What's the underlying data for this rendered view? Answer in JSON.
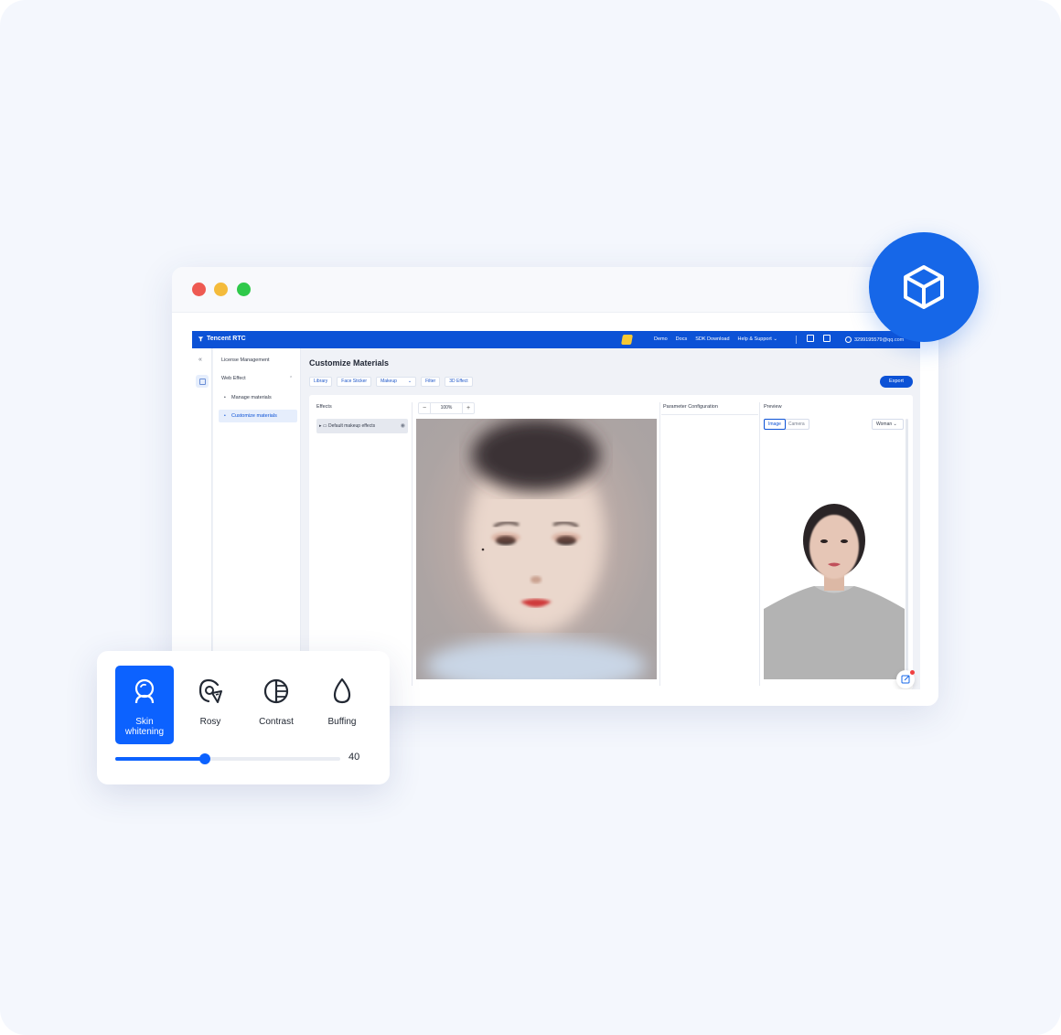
{
  "app": {
    "brand": "Tencent RTC",
    "nav_links": [
      "Demo",
      "Docs",
      "SDK Download",
      "Help & Support"
    ],
    "account_email": "3299195579@qq.com"
  },
  "sidebar": {
    "items": [
      {
        "label": "License Management"
      },
      {
        "label": "Web Effect",
        "expanded": true,
        "children": [
          {
            "label": "Manage materials",
            "active": false
          },
          {
            "label": "Customize materials",
            "active": true
          }
        ]
      }
    ]
  },
  "main": {
    "title": "Customize Materials",
    "tabs": [
      "Library",
      "Face Sticker",
      "Makeup",
      "Filter",
      "3D Effect"
    ],
    "export_label": "Export",
    "effects": {
      "title": "Effects",
      "items": [
        {
          "label": "Default makeup effects"
        }
      ]
    },
    "editor": {
      "zoom": "100%"
    },
    "parameters": {
      "title": "Parameter Configuration"
    },
    "preview": {
      "title": "Preview",
      "modes": [
        "Image",
        "Camera"
      ],
      "selected_mode": "Image",
      "model": "Woman"
    }
  },
  "beauty_panel": {
    "options": [
      {
        "label": "Skin whitening",
        "icon": "skin-whitening-icon",
        "active": true
      },
      {
        "label": "Rosy",
        "icon": "rosy-icon",
        "active": false
      },
      {
        "label": "Contrast",
        "icon": "contrast-icon",
        "active": false
      },
      {
        "label": "Buffing",
        "icon": "buffing-icon",
        "active": false
      }
    ],
    "slider": {
      "value": 40,
      "max": 100
    }
  },
  "colors": {
    "brand": "#0c52d6",
    "accent": "#0c62ff",
    "badge": "#1667e8",
    "traffic_red": "#ee5a52",
    "traffic_yellow": "#f4bb3b",
    "traffic_green": "#2fc94a"
  },
  "badge_icon": "cube-icon"
}
